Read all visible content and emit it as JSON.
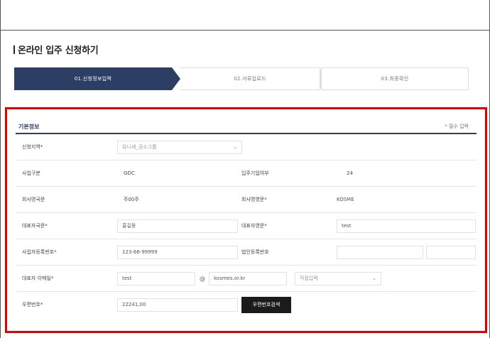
{
  "page": {
    "title": "온라인 입주 신청하기"
  },
  "stepper": {
    "steps": [
      {
        "label": "01.신청정보입력",
        "active": true
      },
      {
        "label": "02.서류업로드",
        "active": false
      },
      {
        "label": "03.최종확인",
        "active": false
      }
    ],
    "active_color": "#2c3e63"
  },
  "form": {
    "highlight_color": "#e00000",
    "section_title": "기본정보",
    "required_note": "* 필수 입력",
    "rows": [
      {
        "left_label": "신청지역*",
        "left_value": "유니세_공소그룹"
      },
      {
        "left_label": "사업구분",
        "left_value": "GDC",
        "right_label": "입주기업여부",
        "right_value": "24"
      },
      {
        "left_label": "회사명국문",
        "left_value": "주00주",
        "right_label": "회사명영문*",
        "right_value": "KOSME"
      },
      {
        "left_label": "대표자국문*",
        "left_value": "홍길동",
        "right_label": "대표자영문*",
        "right_value": "test"
      },
      {
        "left_label": "사업자등록번호*",
        "left_value": "123-66-99999",
        "right_label": "법인등록번호",
        "right_value": ""
      },
      {
        "left_label": "대표자 이메일*",
        "left_value": "test",
        "at": "@",
        "domain": "kosmes.or.kr",
        "domain_select": "직접입력"
      },
      {
        "left_label": "우편번호*",
        "left_value": "22241,00",
        "button": "우편번호검색"
      }
    ]
  }
}
